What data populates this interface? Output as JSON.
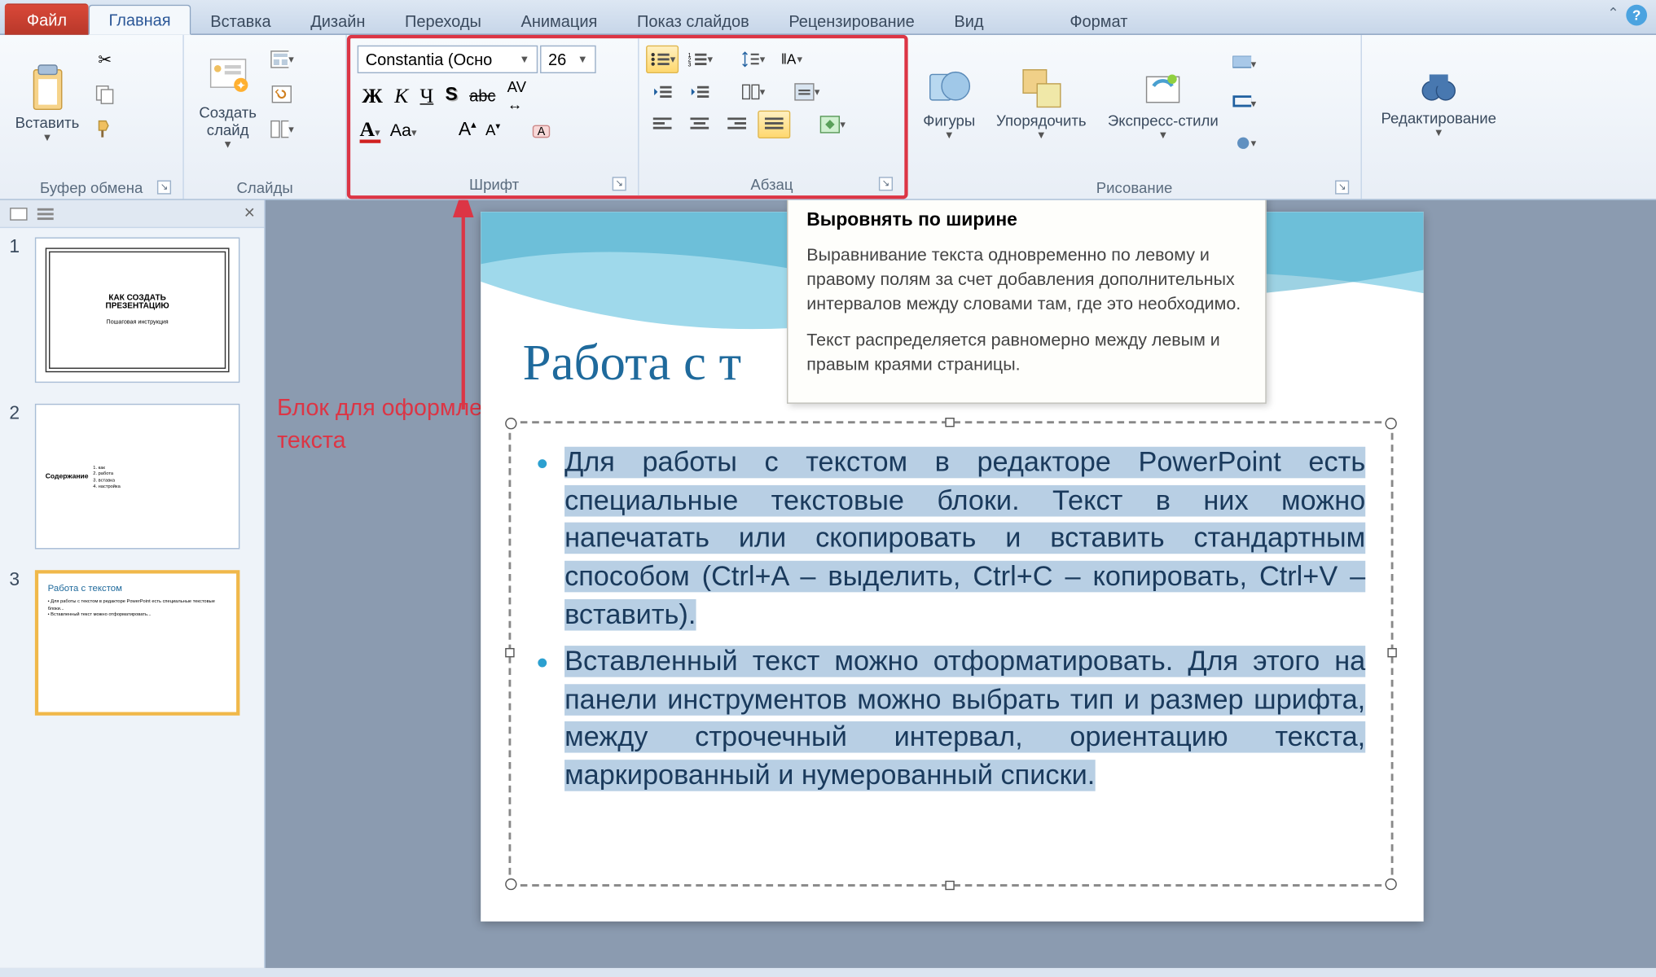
{
  "tabs": {
    "file": "Файл",
    "home": "Главная",
    "insert": "Вставка",
    "design": "Дизайн",
    "transitions": "Переходы",
    "animation": "Анимация",
    "slideshow": "Показ слайдов",
    "review": "Рецензирование",
    "view": "Вид",
    "format": "Формат"
  },
  "ribbon": {
    "clipboard": {
      "label": "Буфер обмена",
      "paste": "Вставить"
    },
    "slides": {
      "label": "Слайды",
      "newslide": "Создать\nслайд"
    },
    "font": {
      "label": "Шрифт",
      "name": "Constantia (Осно",
      "size": "26"
    },
    "paragraph": {
      "label": "Абзац"
    },
    "drawing": {
      "label": "Рисование",
      "shapes": "Фигуры",
      "arrange": "Упорядочить",
      "quickstyles": "Экспресс-стили"
    },
    "editing": {
      "label": "Редактирование"
    }
  },
  "tooltip": {
    "title": "Выровнять по ширине",
    "p1": "Выравнивание текста одновременно по левому и правому полям за счет добавления дополнительных интервалов между словами там, где это необходимо.",
    "p2": "Текст распределяется равномерно между левым и правым краями страницы."
  },
  "annotation": {
    "line1": "Блок для оформления",
    "line2": "текста"
  },
  "slide": {
    "title": "Работа с т",
    "bullet1": "Для работы с текстом в редакторе PowerPoint есть специальные текстовые блоки. Текст в них можно напечатать или скопировать и вставить стандартным способом (Ctrl+A – выделить, Ctrl+C – копировать, Ctrl+V – вставить).",
    "bullet2": "Вставленный текст можно отформатировать. Для этого на панели инструментов можно выбрать тип и размер шрифта, между строчечный интервал, ориентацию текста, маркированный и нумерованный списки."
  },
  "thumbs": {
    "n1": "1",
    "n2": "2",
    "n3": "3",
    "t3title": "Работа с текстом"
  }
}
